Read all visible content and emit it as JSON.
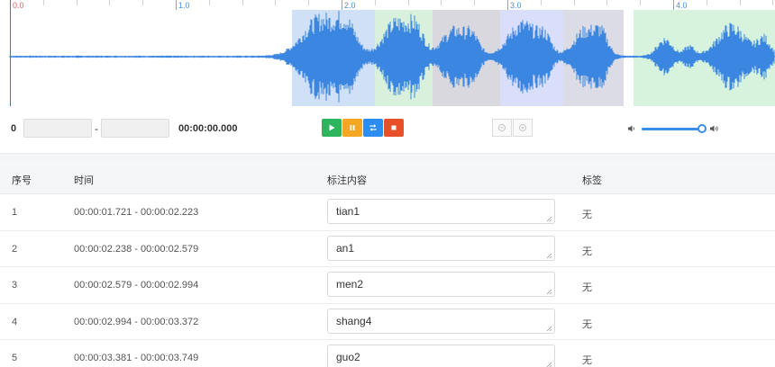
{
  "timeline": {
    "labels": [
      {
        "text": "0.0",
        "color": "#e06060"
      },
      {
        "text": "1.0",
        "color": "#4a90d9"
      },
      {
        "text": "2.0",
        "color": "#4a90d9"
      },
      {
        "text": "3.0",
        "color": "#4a90d9"
      },
      {
        "text": "4.0",
        "color": "#4a90d9"
      }
    ]
  },
  "regions": [
    {
      "color": "#cfe0f7"
    },
    {
      "color": "#d9f1dc"
    },
    {
      "color": "#d8d8de"
    },
    {
      "color": "#d9dffb"
    },
    {
      "color": "#dcdce6"
    },
    {
      "color": "#d7f3de"
    }
  ],
  "waveform": {
    "color": "#3a86e0"
  },
  "controls": {
    "zero_label": "0",
    "start_value": "",
    "dash": "-",
    "end_value": "",
    "time_readout": "00:00:00.000",
    "play_icon": "play-icon",
    "pause_icon": "pause-icon",
    "loop_icon": "loop-icon",
    "stop_icon": "stop-icon",
    "zoom_out_icon": "zoom-out-icon",
    "zoom_in_icon": "zoom-in-icon",
    "volume_level": 0.93,
    "colors": {
      "play": "#2db55d",
      "pause": "#f5a623",
      "loop": "#2d8cf0",
      "stop": "#e8502a"
    }
  },
  "table": {
    "headers": {
      "index": "序号",
      "time": "时间",
      "content": "标注内容",
      "tag": "标签"
    },
    "rows": [
      {
        "index": "1",
        "time": "00:00:01.721 - 00:00:02.223",
        "content": "tian1",
        "tag": "无"
      },
      {
        "index": "2",
        "time": "00:00:02.238 - 00:00:02.579",
        "content": "an1",
        "tag": "无"
      },
      {
        "index": "3",
        "time": "00:00:02.579 - 00:00:02.994",
        "content": "men2",
        "tag": "无"
      },
      {
        "index": "4",
        "time": "00:00:02.994 - 00:00:03.372",
        "content": "shang4",
        "tag": "无"
      },
      {
        "index": "5",
        "time": "00:00:03.381 - 00:00:03.749",
        "content": "guo2",
        "tag": "无"
      }
    ]
  }
}
